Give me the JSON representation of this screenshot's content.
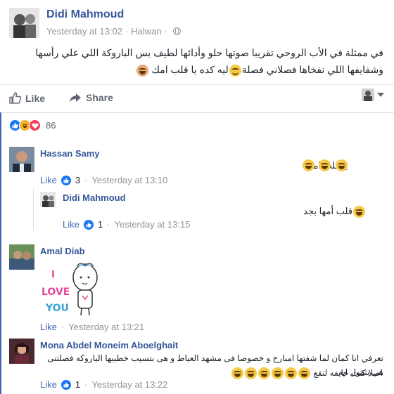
{
  "post": {
    "author": "Didi Mahmoud",
    "time": "Yesterday at 13:02",
    "location": "Halwan",
    "separator": "·",
    "text": "في ممثلة في الأب الروحي تقريبا صوتها حلو وأدائها لطيف بس الباروكة اللي علي رأسها وشفايفها اللي نفخاها فصلاني فصلة",
    "text_tail": "ليه كده يا قلب امك"
  },
  "actions": {
    "like_label": "Like",
    "share_label": "Share"
  },
  "reactions": {
    "count": "86",
    "like_icon": "like-reaction-icon",
    "haha_icon": "haha-reaction-icon",
    "love_icon": "love-reaction-icon",
    "colors": {
      "like": "#1877f2",
      "haha": "#f7b125",
      "love": "#f33e58"
    }
  },
  "comments": [
    {
      "name": "Hassan Samy",
      "text": "يا قلب امك",
      "like_label": "Like",
      "like_count": "3",
      "time": "Yesterday at 13:10",
      "reply": {
        "name": "Didi Mahmoud",
        "text": "قلب أمها بجد",
        "like_label": "Like",
        "like_count": "1",
        "time": "Yesterday at 13:15"
      }
    },
    {
      "name": "Amal Diab",
      "sticker_text": [
        "I",
        "LOVE",
        "YOU"
      ],
      "like_label": "Like",
      "time": "Yesterday at 13:21"
    },
    {
      "name": "Mona Abdel Moneim Aboelghait",
      "text_line1": "تعرفي انا كمان لما شفتها امبارح و خصوصا فى مشهد العياط و هى بتسيب خطيبها الباروكه فصلتنى هى بتقول ايه",
      "text_line2": "اصلا كنت خايفه لتقع",
      "like_label": "Like",
      "like_count": "1",
      "time": "Yesterday at 13:22"
    }
  ],
  "colors": {
    "link": "#365899",
    "meta": "#90949c",
    "accent": "#4267b2"
  }
}
